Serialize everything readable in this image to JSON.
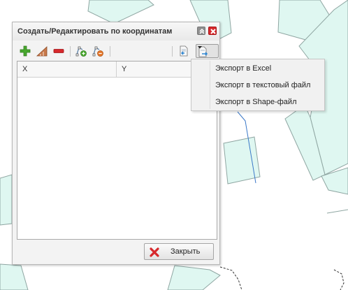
{
  "dialog": {
    "title": "Создать/Редактировать по координатам",
    "title_buttons": [
      {
        "name": "collapse",
        "icon": "double-chevron-up-icon"
      },
      {
        "name": "close",
        "icon": "close-icon"
      }
    ],
    "toolbar": [
      {
        "name": "add",
        "icon": "plus-icon"
      },
      {
        "name": "edit",
        "icon": "ruler-icon"
      },
      {
        "name": "remove",
        "icon": "minus-icon"
      },
      {
        "name": "add-vertex",
        "icon": "vertex-add-icon"
      },
      {
        "name": "remove-vertex",
        "icon": "vertex-remove-icon"
      },
      {
        "name": "import",
        "icon": "document-import-icon"
      },
      {
        "name": "export",
        "icon": "document-export-icon",
        "state": "pressed"
      }
    ],
    "grid": {
      "columns": [
        "X",
        "Y"
      ],
      "rows": []
    },
    "close_button_label": "Закрыть"
  },
  "export_menu": {
    "items": [
      "Экспорт в Excel",
      "Экспорт в текстовый файл",
      "Экспорт в Shape-файл"
    ]
  },
  "colors": {
    "map_fill": "#dff7f1",
    "map_stroke": "#8fa6a2",
    "boundary_blue": "#3a78c8",
    "accent_red": "#d7282c",
    "accent_green": "#48a82e"
  }
}
